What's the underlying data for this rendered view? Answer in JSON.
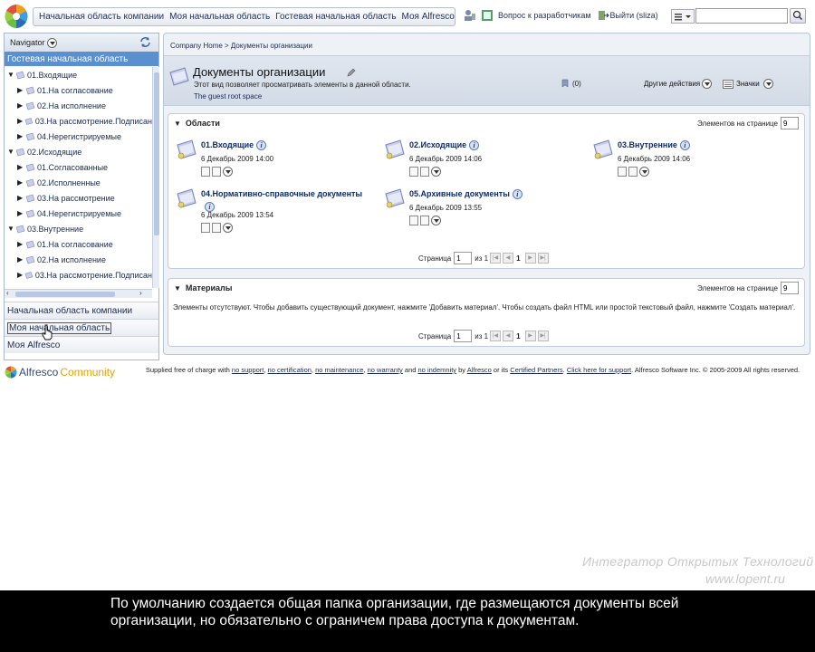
{
  "toolbar": {
    "links": [
      "Начальная область компании",
      "Моя начальная область",
      "Гостевая начальная область",
      "Моя Alfresco"
    ],
    "dev_question": "Вопрос к разработчикам",
    "logout": "Выйти (sliza)",
    "search_value": ""
  },
  "sidebar": {
    "header": "Navigator",
    "active_section": "Гостевая начальная область",
    "tree": [
      {
        "label": "01.Входящие",
        "level": 0,
        "expanded": true
      },
      {
        "label": "01.На согласование",
        "level": 1,
        "expanded": false
      },
      {
        "label": "02.На исполнение",
        "level": 1,
        "expanded": false
      },
      {
        "label": "03.На рассмотрение.Подписан",
        "level": 1,
        "expanded": false
      },
      {
        "label": "04.Нерегистрируемые",
        "level": 1,
        "expanded": false
      },
      {
        "label": "02.Исходящие",
        "level": 0,
        "expanded": true
      },
      {
        "label": "01.Согласованные",
        "level": 1,
        "expanded": false
      },
      {
        "label": "02.Исполненные",
        "level": 1,
        "expanded": false
      },
      {
        "label": "03.На рассмотрение",
        "level": 1,
        "expanded": false
      },
      {
        "label": "04.Нерегистрируемые",
        "level": 1,
        "expanded": false
      },
      {
        "label": "03.Внутренние",
        "level": 0,
        "expanded": true
      },
      {
        "label": "01.На согласование",
        "level": 1,
        "expanded": false
      },
      {
        "label": "02.На исполнение",
        "level": 1,
        "expanded": false
      },
      {
        "label": "03.На рассмотрение.Подписан",
        "level": 1,
        "expanded": false
      }
    ],
    "sections": [
      "Начальная область компании",
      "Моя начальная область",
      "Моя Alfresco"
    ]
  },
  "main": {
    "breadcrumb": "Company Home > Документы организации",
    "title": "Документы организации",
    "description": "Этот вид позволяет просматривать элементы в данной области.",
    "description2": "The guest root space",
    "notify_count": "(0)",
    "more_actions": "Другие действия",
    "icons_view": "Значки",
    "spaces_panel": {
      "title": "Области",
      "per_page_label": "Элементов на странице",
      "per_page": "9",
      "items": [
        {
          "name": "01.Входящие",
          "date": "6 Декабрь 2009 14:00"
        },
        {
          "name": "02.Исходящие",
          "date": "6 Декабрь 2009 14:06"
        },
        {
          "name": "03.Внутренние",
          "date": "6 Декабрь 2009 14:06"
        },
        {
          "name": "04.Нормативно-справочные документы",
          "date": "6 Декабрь 2009 13:54"
        },
        {
          "name": "05.Архивные документы",
          "date": "6 Декабрь 2009 13:55"
        }
      ],
      "pager": {
        "label": "Страница",
        "page": "1",
        "of": "из 1",
        "current": "1"
      }
    },
    "content_panel": {
      "title": "Материалы",
      "per_page_label": "Элементов на странице",
      "per_page": "9",
      "empty_text": "Элементы отсутствуют. Чтобы добавить существующий документ, нажмите 'Добавить материал'. Чтобы создать файл HTML или простой текстовый файл, нажмите 'Создать материал'.",
      "pager": {
        "label": "Страница",
        "page": "1",
        "of": "из 1",
        "current": "1"
      }
    }
  },
  "footer": {
    "logo_part1": "Alfresco",
    "logo_part2": "Community",
    "text_prefix": "Supplied free of charge with",
    "no_support": "no support",
    "no_certification": "no certification",
    "no_maintenance": "no maintenance",
    "no_warranty": "no warranty",
    "and": "and",
    "no_indemnity": "no indemnity",
    "by": "by",
    "alfresco": "Alfresco",
    "or_its": "or its",
    "certified_partners": "Certified Partners",
    "click_here": "Click here for support",
    "copyright": "Alfresco Software Inc. © 2005-2009 All rights reserved."
  },
  "watermark": {
    "line1": "Интегратор Открытых Технологий",
    "line2": "www.lopent.ru"
  },
  "subtitle": "По умолчанию создается общая папка организации, где размещаются документы всей организации, но обязательно с ограничем права доступа к документам."
}
